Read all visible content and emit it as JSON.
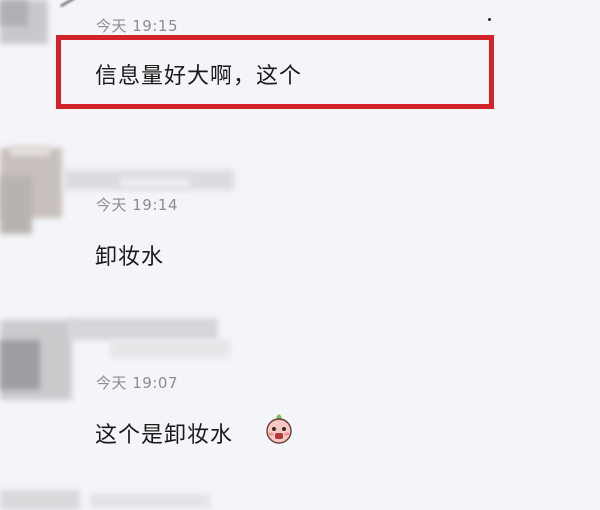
{
  "messages": [
    {
      "time": "今天 19:15",
      "text": "信息量好大啊，这个",
      "highlighted": true
    },
    {
      "time": "今天 19:14",
      "text": "卸妆水"
    },
    {
      "time": "今天 19:07",
      "text": "这个是卸妆水",
      "sticker": "peach-face-sticker-icon"
    }
  ],
  "colors": {
    "background": "#f4f5f9",
    "timestamp": "#8a8d94",
    "message_text": "#1a1a1a",
    "highlight_border": "#d3242a"
  }
}
